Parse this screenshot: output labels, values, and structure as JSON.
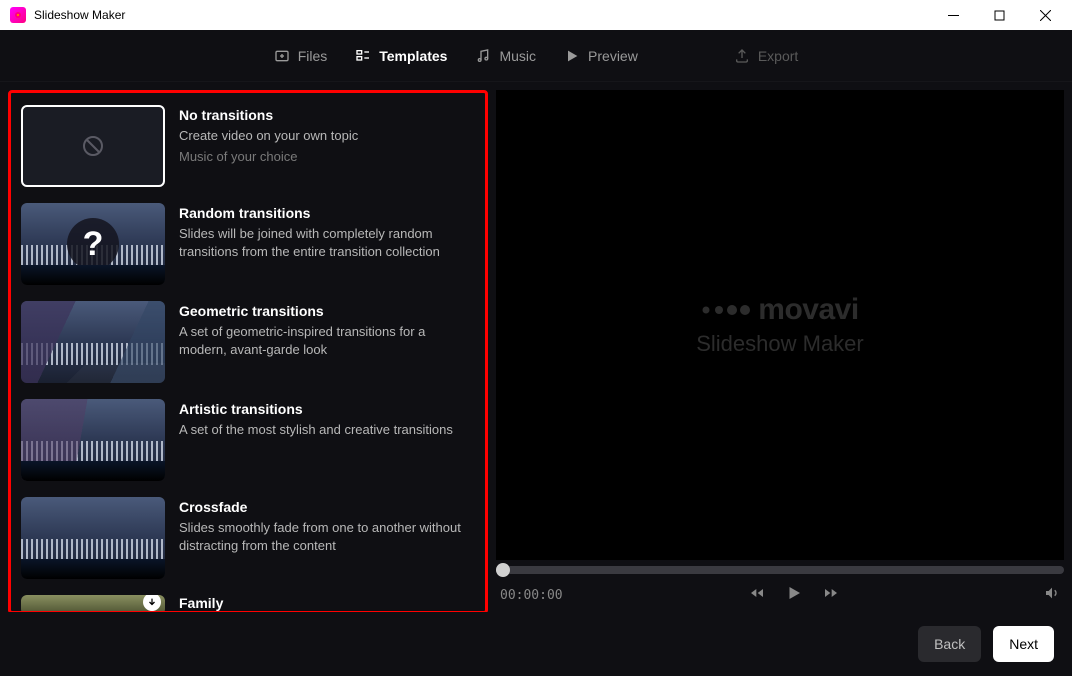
{
  "window": {
    "title": "Slideshow Maker"
  },
  "nav": {
    "files": "Files",
    "templates": "Templates",
    "music": "Music",
    "preview": "Preview",
    "export": "Export"
  },
  "templates": [
    {
      "title": "No transitions",
      "desc": "Create video on your own topic",
      "sub": "Music of your choice"
    },
    {
      "title": "Random transitions",
      "desc": "Slides will be joined with completely random transitions from the entire transition collection"
    },
    {
      "title": "Geometric transitions",
      "desc": "A set of geometric-inspired transitions for a modern, avant-garde look"
    },
    {
      "title": "Artistic transitions",
      "desc": "A set of the most stylish and creative transitions"
    },
    {
      "title": "Crossfade",
      "desc": "Slides smoothly fade from one to another without distracting from the content"
    },
    {
      "title": "Family",
      "desc": ""
    }
  ],
  "watermark": {
    "brand": "movavi",
    "product": "Slideshow Maker"
  },
  "playback": {
    "time": "00:00:00"
  },
  "buttons": {
    "back": "Back",
    "next": "Next"
  }
}
